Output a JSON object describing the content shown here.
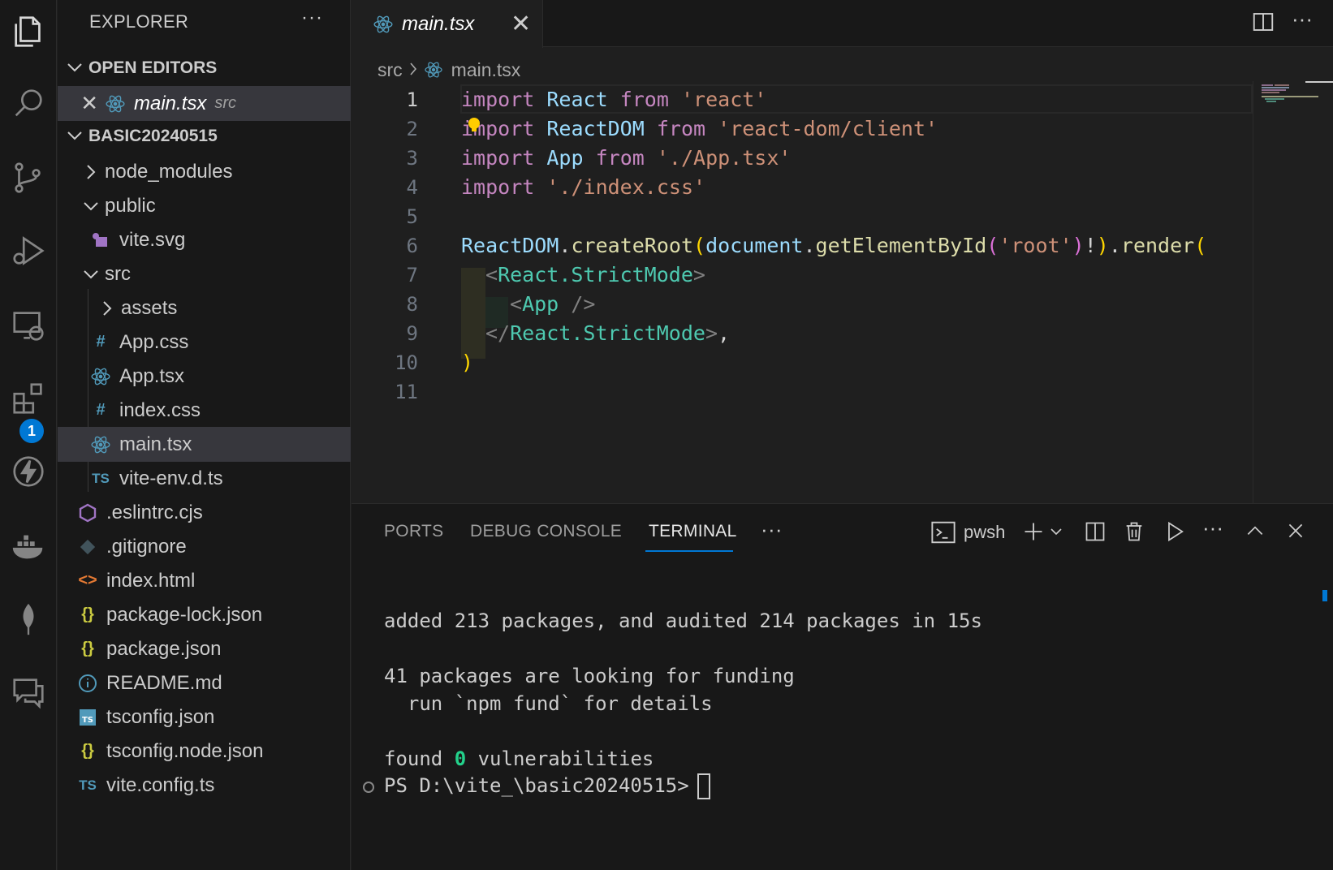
{
  "activity_bar": {
    "items": [
      "explorer",
      "search",
      "source-control",
      "run-and-debug",
      "remote-explorer",
      "extensions",
      "thunder-client",
      "docker",
      "mongodb",
      "chat"
    ],
    "extensions_badge": "1"
  },
  "sidebar": {
    "title": "EXPLORER",
    "more": "···",
    "open_editors": {
      "header": "OPEN EDITORS",
      "items": [
        {
          "close": "✕",
          "name": "main.tsx",
          "folder": "src"
        }
      ]
    },
    "project": {
      "header": "BASIC20240515",
      "tree": [
        {
          "name": "node_modules",
          "kind": "folder",
          "expanded": false
        },
        {
          "name": "public",
          "kind": "folder",
          "expanded": true
        },
        {
          "name": "vite.svg",
          "kind": "svg"
        },
        {
          "name": "src",
          "kind": "folder",
          "expanded": true
        },
        {
          "name": "assets",
          "kind": "folder",
          "expanded": false
        },
        {
          "name": "App.css",
          "kind": "css"
        },
        {
          "name": "App.tsx",
          "kind": "react"
        },
        {
          "name": "index.css",
          "kind": "css"
        },
        {
          "name": "main.tsx",
          "kind": "react",
          "selected": true
        },
        {
          "name": "vite-env.d.ts",
          "kind": "ts"
        },
        {
          "name": ".eslintrc.cjs",
          "kind": "eslint"
        },
        {
          "name": ".gitignore",
          "kind": "git"
        },
        {
          "name": "index.html",
          "kind": "html"
        },
        {
          "name": "package-lock.json",
          "kind": "json"
        },
        {
          "name": "package.json",
          "kind": "json"
        },
        {
          "name": "README.md",
          "kind": "info"
        },
        {
          "name": "tsconfig.json",
          "kind": "tsconfig"
        },
        {
          "name": "tsconfig.node.json",
          "kind": "json"
        },
        {
          "name": "vite.config.ts",
          "kind": "ts"
        }
      ]
    }
  },
  "editor": {
    "tab": {
      "label": "main.tsx",
      "close": "✕"
    },
    "breadcrumb": {
      "folder": "src",
      "file": "main.tsx"
    },
    "line_numbers": [
      "1",
      "2",
      "3",
      "4",
      "5",
      "6",
      "7",
      "8",
      "9",
      "10",
      "11"
    ],
    "current_line": "1",
    "code": {
      "l1": {
        "import": "import",
        "name": "React",
        "from": "from",
        "str": "'react'"
      },
      "l2": {
        "import": "import",
        "name": "ReactDOM",
        "from": "from",
        "str": "'react-dom/client'"
      },
      "l3": {
        "import": "import",
        "name": "App",
        "from": "from",
        "str": "'./App.tsx'"
      },
      "l4": {
        "import": "import",
        "str": "'./index.css'"
      },
      "l6": {
        "obj": "ReactDOM",
        "dot1": ".",
        "fn1": "createRoot",
        "p1": "(",
        "obj2": "document",
        "dot2": ".",
        "fn2": "getElementById",
        "p2": "(",
        "str": "'root'",
        "p3": ")",
        "bang": "!",
        "p4": ")",
        "dot3": ".",
        "fn3": "render",
        "p5": "("
      },
      "l7": {
        "open": "<",
        "tag": "React.StrictMode",
        "close": ">"
      },
      "l8": {
        "open": "<",
        "tag": "App",
        "close": " />"
      },
      "l9": {
        "open": "</",
        "tag": "React.StrictMode",
        "close": ">",
        "comma": ","
      },
      "l10": {
        "paren": ")"
      }
    }
  },
  "panel": {
    "tabs": [
      "PORTS",
      "DEBUG CONSOLE",
      "TERMINAL"
    ],
    "active_tab": "TERMINAL",
    "more": "···",
    "shell": "pwsh",
    "terminal": {
      "line1": "added 213 packages, and audited 214 packages in 15s",
      "line2": "41 packages are looking for funding",
      "line3": "  run `npm fund` for details",
      "line4_pre": "found ",
      "line4_num": "0",
      "line4_post": " vulnerabilities",
      "prompt": "PS D:\\vite_\\basic20240515>"
    }
  },
  "colors": {
    "accent": "#0078d4",
    "keyword": "#c586c0",
    "variable": "#9cdcfe",
    "string": "#ce9178",
    "function": "#dcdcaa",
    "tag": "#4ec9b0",
    "react_icon": "#519aba",
    "json_icon": "#cbcb41"
  }
}
